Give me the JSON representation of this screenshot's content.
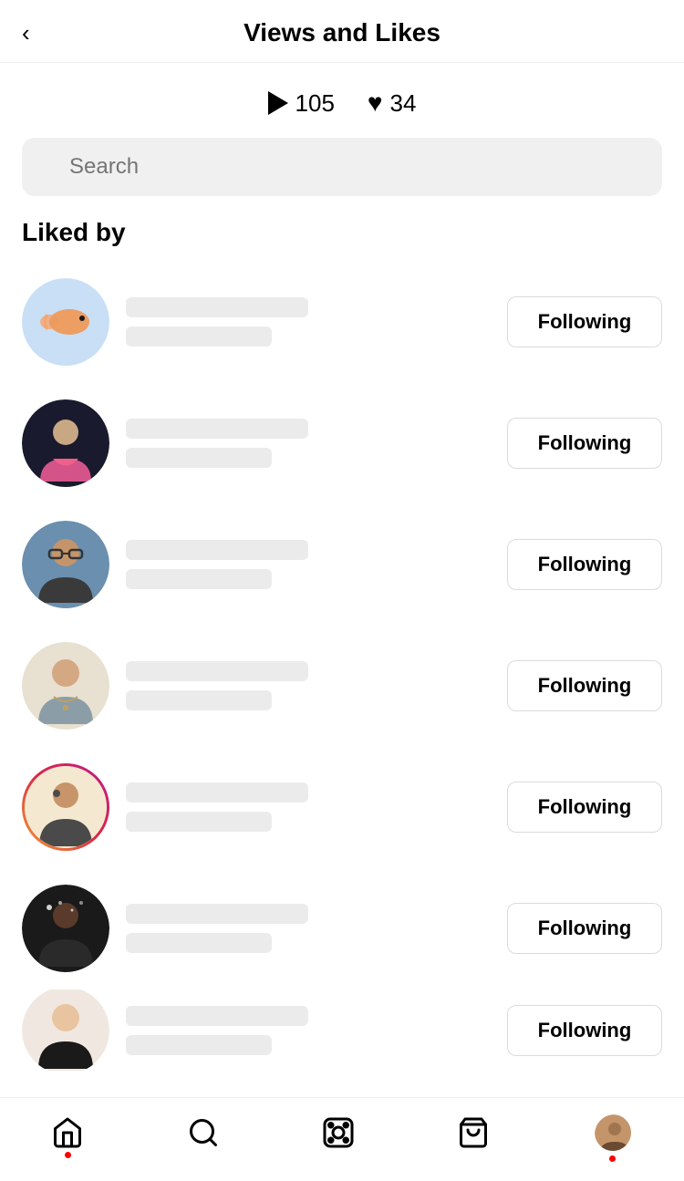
{
  "header": {
    "back_label": "‹",
    "title": "Views and Likes"
  },
  "stats": {
    "views_count": "105",
    "likes_count": "34"
  },
  "search": {
    "placeholder": "Search"
  },
  "liked_by": {
    "section_title": "Liked by",
    "users": [
      {
        "id": 1,
        "following_label": "Following",
        "avatar_class": "av1",
        "story_ring": false
      },
      {
        "id": 2,
        "following_label": "Following",
        "avatar_class": "av2",
        "story_ring": false
      },
      {
        "id": 3,
        "following_label": "Following",
        "avatar_class": "av3",
        "story_ring": false
      },
      {
        "id": 4,
        "following_label": "Following",
        "avatar_class": "av4",
        "story_ring": false
      },
      {
        "id": 5,
        "following_label": "Following",
        "avatar_class": "av5",
        "story_ring": true
      },
      {
        "id": 6,
        "following_label": "Following",
        "avatar_class": "av6",
        "story_ring": false
      },
      {
        "id": 7,
        "following_label": "Following",
        "avatar_class": "av7",
        "story_ring": false
      }
    ]
  },
  "bottom_nav": {
    "home_label": "home",
    "search_label": "search",
    "reels_label": "reels",
    "shop_label": "shop",
    "profile_label": "profile"
  }
}
